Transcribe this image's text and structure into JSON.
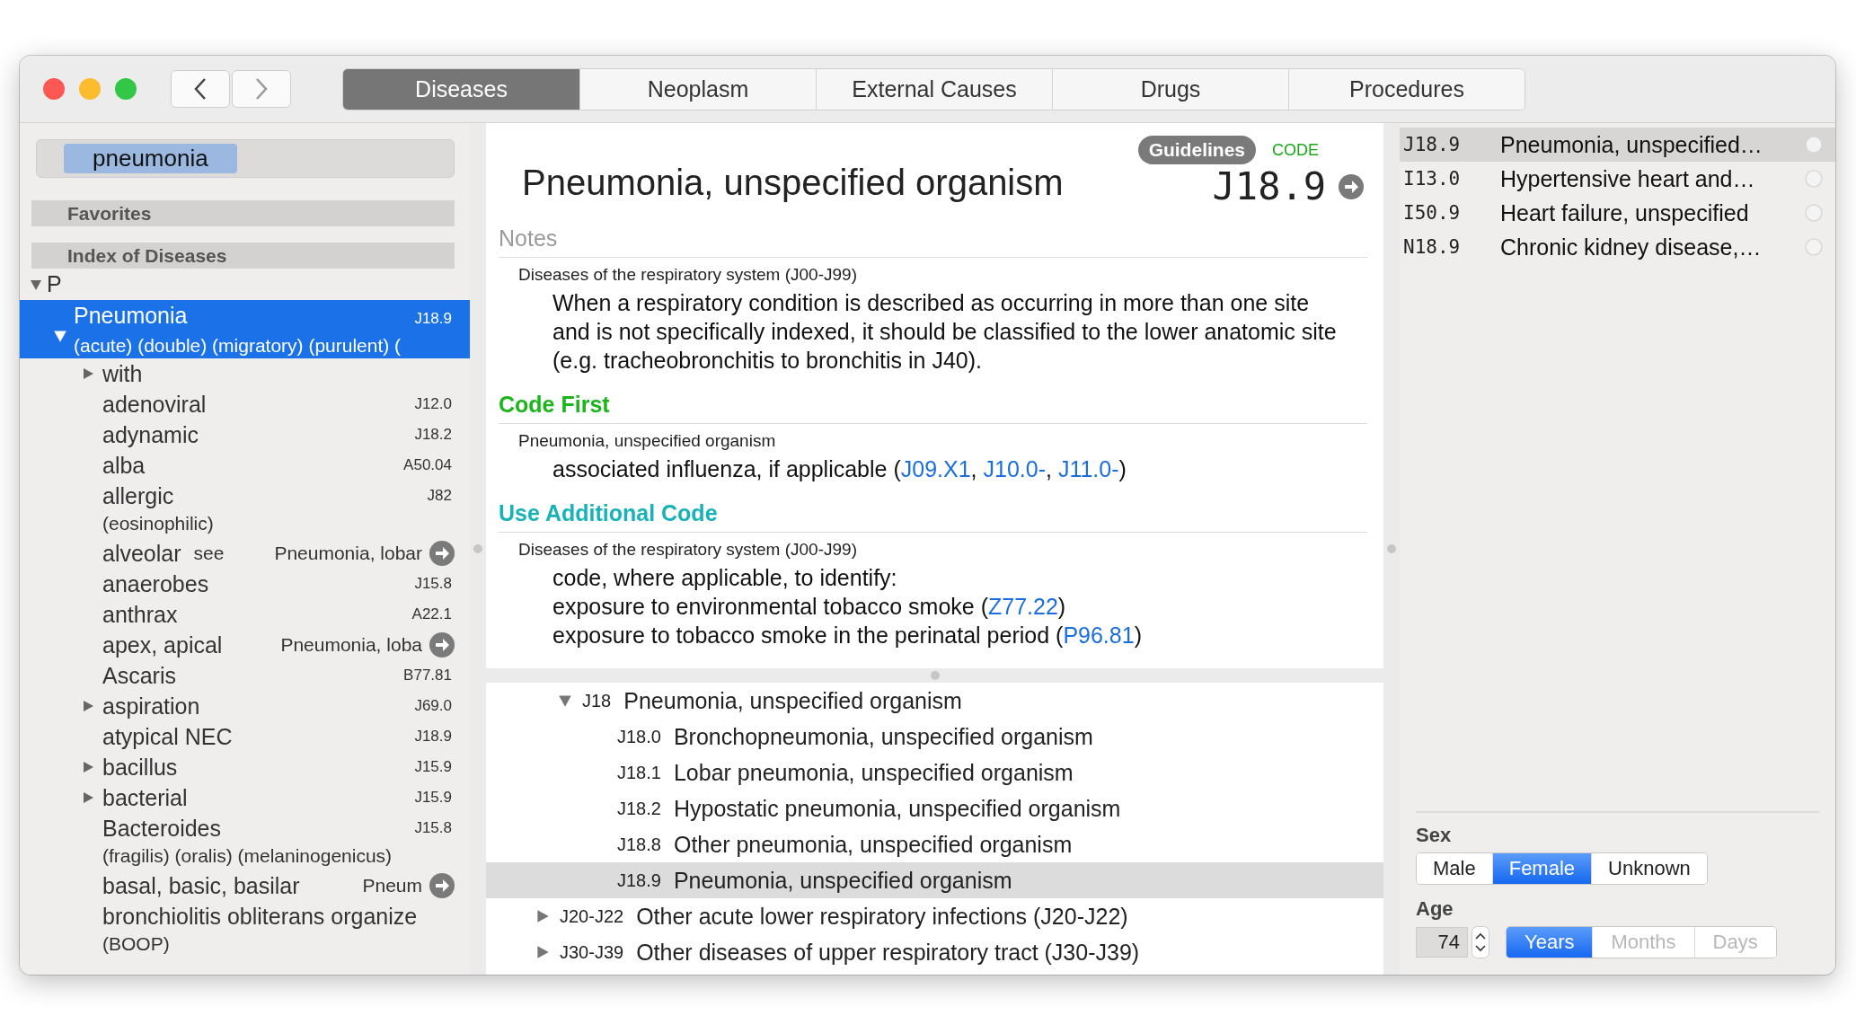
{
  "tabs": [
    {
      "label": "Diseases",
      "selected": true
    },
    {
      "label": "Neoplasm",
      "selected": false
    },
    {
      "label": "External Causes",
      "selected": false
    },
    {
      "label": "Drugs",
      "selected": false
    },
    {
      "label": "Procedures",
      "selected": false
    }
  ],
  "search": {
    "value": "pneumonia"
  },
  "sidebar": {
    "sections": [
      {
        "label": "Favorites"
      },
      {
        "label": "Index of Diseases"
      }
    ],
    "letter": {
      "label": "P",
      "expanded": true
    },
    "entries": [
      {
        "term": "Pneumonia",
        "code": "J18.9",
        "note": "(acute) (double) (migratory) (purulent) (",
        "expanded": true,
        "selected": true,
        "children": [
          {
            "kind": "branch",
            "term": "with",
            "expanded": false,
            "selected": false
          },
          {
            "kind": "leaf",
            "term": "adenoviral",
            "code": "J12.0",
            "selected": false
          },
          {
            "kind": "leaf",
            "term": "adynamic",
            "code": "J18.2",
            "selected": false
          },
          {
            "kind": "leaf",
            "term": "alba",
            "code": "A50.04",
            "selected": false
          },
          {
            "kind": "leaf",
            "term": "allergic",
            "code": "J82",
            "note": "(eosinophilic)",
            "selected": false
          },
          {
            "kind": "see",
            "term": "alveolar",
            "see_label": "see",
            "target": "Pneumonia, lobar",
            "selected": false
          },
          {
            "kind": "leaf",
            "term": "anaerobes",
            "code": "J15.8",
            "selected": false
          },
          {
            "kind": "leaf",
            "term": "anthrax",
            "code": "A22.1",
            "selected": false
          },
          {
            "kind": "see",
            "term": "apex, apical",
            "target": "Pneumonia, loba",
            "selected": false
          },
          {
            "kind": "leaf",
            "term": "Ascaris",
            "code": "B77.81",
            "selected": false
          },
          {
            "kind": "branch",
            "term": "aspiration",
            "code": "J69.0",
            "expanded": false,
            "selected": false
          },
          {
            "kind": "leaf",
            "term": "atypical NEC",
            "code": "J18.9",
            "selected": false
          },
          {
            "kind": "branch",
            "term": "bacillus",
            "code": "J15.9",
            "expanded": false,
            "selected": false
          },
          {
            "kind": "branch",
            "term": "bacterial",
            "code": "J15.9",
            "expanded": false,
            "selected": false
          },
          {
            "kind": "leaf",
            "term": "Bacteroides",
            "code": "J15.8",
            "note": "(fragilis) (oralis) (melaninogenicus)",
            "selected": false
          },
          {
            "kind": "see",
            "term": "basal, basic, basilar",
            "target": "Pneum",
            "selected": false
          },
          {
            "kind": "leaf",
            "term": "bronchiolitis obliterans organize",
            "note": "(BOOP)",
            "selected": false
          }
        ]
      }
    ]
  },
  "detail": {
    "guidelines_button": "Guidelines",
    "code_label": "CODE",
    "title": "Pneumonia, unspecified organism",
    "code": "J18.9",
    "sections": [
      {
        "kind": "notes",
        "heading": "Notes",
        "source": "Diseases of the respiratory system (J00-J99)",
        "lines": [
          [
            {
              "kind": "text",
              "text": "When a respiratory condition is described as occurring in more than one site and is not specifically indexed, it should be classified to the lower anatomic site (e.g. tracheobronchitis to bronchitis in J40)."
            }
          ]
        ]
      },
      {
        "kind": "code_first",
        "heading": "Code First",
        "source": "Pneumonia, unspecified organism",
        "lines": [
          [
            {
              "kind": "text",
              "text": "associated influenza, if applicable ("
            },
            {
              "kind": "link",
              "text": "J09.X1"
            },
            {
              "kind": "text",
              "text": ", "
            },
            {
              "kind": "link",
              "text": "J10.0-"
            },
            {
              "kind": "text",
              "text": ", "
            },
            {
              "kind": "link",
              "text": "J11.0-"
            },
            {
              "kind": "text",
              "text": ")"
            }
          ]
        ]
      },
      {
        "kind": "use_additional",
        "heading": "Use Additional Code",
        "source": "Diseases of the respiratory system (J00-J99)",
        "lines": [
          [
            {
              "kind": "text",
              "text": "code, where applicable, to identify:"
            }
          ],
          [
            {
              "kind": "text",
              "text": "exposure to environmental tobacco smoke ("
            },
            {
              "kind": "link",
              "text": "Z77.22"
            },
            {
              "kind": "text",
              "text": ")"
            }
          ],
          [
            {
              "kind": "text",
              "text": "exposure to tobacco smoke in the perinatal period ("
            },
            {
              "kind": "link",
              "text": "P96.81"
            },
            {
              "kind": "text",
              "text": ")"
            }
          ]
        ]
      }
    ]
  },
  "tree": [
    {
      "code": "J18",
      "label": "Pneumonia, unspecified organism",
      "expanded": true,
      "selected": false,
      "children": [
        {
          "code": "J18.0",
          "label": "Bronchopneumonia, unspecified organism",
          "selected": false
        },
        {
          "code": "J18.1",
          "label": "Lobar pneumonia, unspecified organism",
          "selected": false
        },
        {
          "code": "J18.2",
          "label": "Hypostatic pneumonia, unspecified organism",
          "selected": false
        },
        {
          "code": "J18.8",
          "label": "Other pneumonia, unspecified organism",
          "selected": false
        },
        {
          "code": "J18.9",
          "label": "Pneumonia, unspecified organism",
          "selected": true
        }
      ]
    },
    {
      "code": "J20-J22",
      "label": "Other acute lower respiratory infections (J20-J22)",
      "expanded": false,
      "selected": false
    },
    {
      "code": "J30-J39",
      "label": "Other diseases of upper respiratory tract (J30-J39)",
      "expanded": false,
      "selected": false
    }
  ],
  "recent": [
    {
      "code": "J18.9",
      "label": "Pneumonia, unspecified…",
      "selected": true
    },
    {
      "code": "I13.0",
      "label": "Hypertensive heart and…",
      "selected": false
    },
    {
      "code": "I50.9",
      "label": "Heart failure, unspecified",
      "selected": false
    },
    {
      "code": "N18.9",
      "label": "Chronic kidney disease,…",
      "selected": false
    }
  ],
  "patient": {
    "sex_label": "Sex",
    "sex_options": [
      {
        "label": "Male",
        "selected": false
      },
      {
        "label": "Female",
        "selected": true
      },
      {
        "label": "Unknown",
        "selected": false
      }
    ],
    "age_label": "Age",
    "age": "74",
    "age_units": [
      {
        "label": "Years",
        "selected": true,
        "disabled": false
      },
      {
        "label": "Months",
        "selected": false,
        "disabled": true
      },
      {
        "label": "Days",
        "selected": false,
        "disabled": true
      }
    ]
  }
}
